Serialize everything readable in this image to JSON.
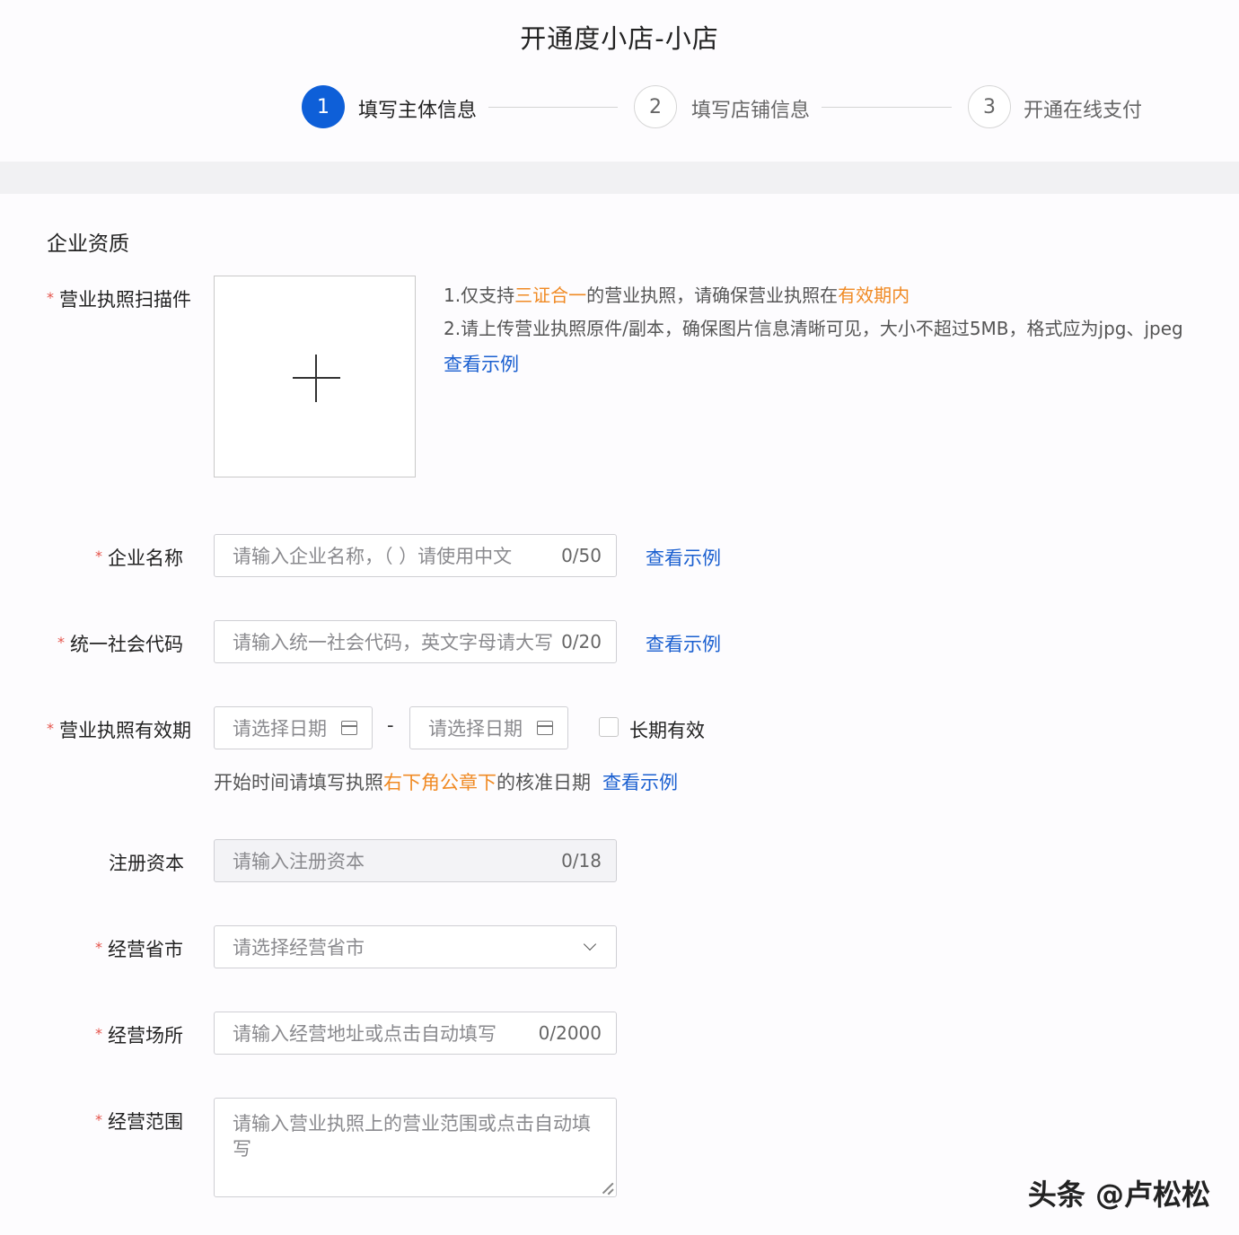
{
  "page": {
    "title": "开通度小店-小店"
  },
  "steps": [
    {
      "number": "1",
      "label": "填写主体信息",
      "state": "active"
    },
    {
      "number": "2",
      "label": "填写店铺信息",
      "state": "inactive"
    },
    {
      "number": "3",
      "label": "开通在线支付",
      "state": "inactive"
    }
  ],
  "section": {
    "title": "企业资质"
  },
  "license_scan": {
    "required_mark": "*",
    "label": "营业执照扫描件",
    "upload_icon": "plus-icon",
    "tip1_a": "1.仅支持",
    "tip1_b": "三证合一",
    "tip1_c": "的营业执照，请确保营业执照在",
    "tip1_d": "有效期内",
    "tip2": "2.请上传营业执照原件/副本，确保图片信息清晰可见，大小不超过5MB，格式应为jpg、jpeg",
    "example_link": "查看示例"
  },
  "company_name": {
    "required_mark": "*",
    "label": "企业名称",
    "placeholder": "请输入企业名称，（ ）请使用中文",
    "count": "0/50",
    "example_link": "查看示例"
  },
  "credit_code": {
    "required_mark": "*",
    "label": "统一社会代码",
    "placeholder": "请输入统一社会代码，英文字母请大写",
    "count": "0/20",
    "example_link": "查看示例"
  },
  "validity": {
    "required_mark": "*",
    "label": "营业执照有效期",
    "start_placeholder": "请选择日期",
    "separator": "-",
    "end_placeholder": "请选择日期",
    "long_term_label": "长期有效",
    "long_term_checked": false,
    "hint_a": "开始时间请填写执照",
    "hint_b": "右下角公章下",
    "hint_c": "的核准日期",
    "example_link": "查看示例",
    "icon": "calendar-icon"
  },
  "registered_capital": {
    "label": "注册资本",
    "placeholder": "请输入注册资本",
    "count": "0/18"
  },
  "province_city": {
    "required_mark": "*",
    "label": "经营省市",
    "placeholder": "请选择经营省市",
    "icon": "chevron-down-icon"
  },
  "business_place": {
    "required_mark": "*",
    "label": "经营场所",
    "placeholder": "请输入经营地址或点击自动填写",
    "count": "0/2000"
  },
  "business_scope": {
    "required_mark": "*",
    "label": "经营范围",
    "placeholder": "请输入营业执照上的营业范围或点击自动填写"
  },
  "watermark": {
    "text": "头条 @卢松松"
  },
  "colors": {
    "accent": "#0e5fd8",
    "link": "#1a5fd0",
    "highlight": "#f08a24",
    "required": "#e5534b"
  }
}
